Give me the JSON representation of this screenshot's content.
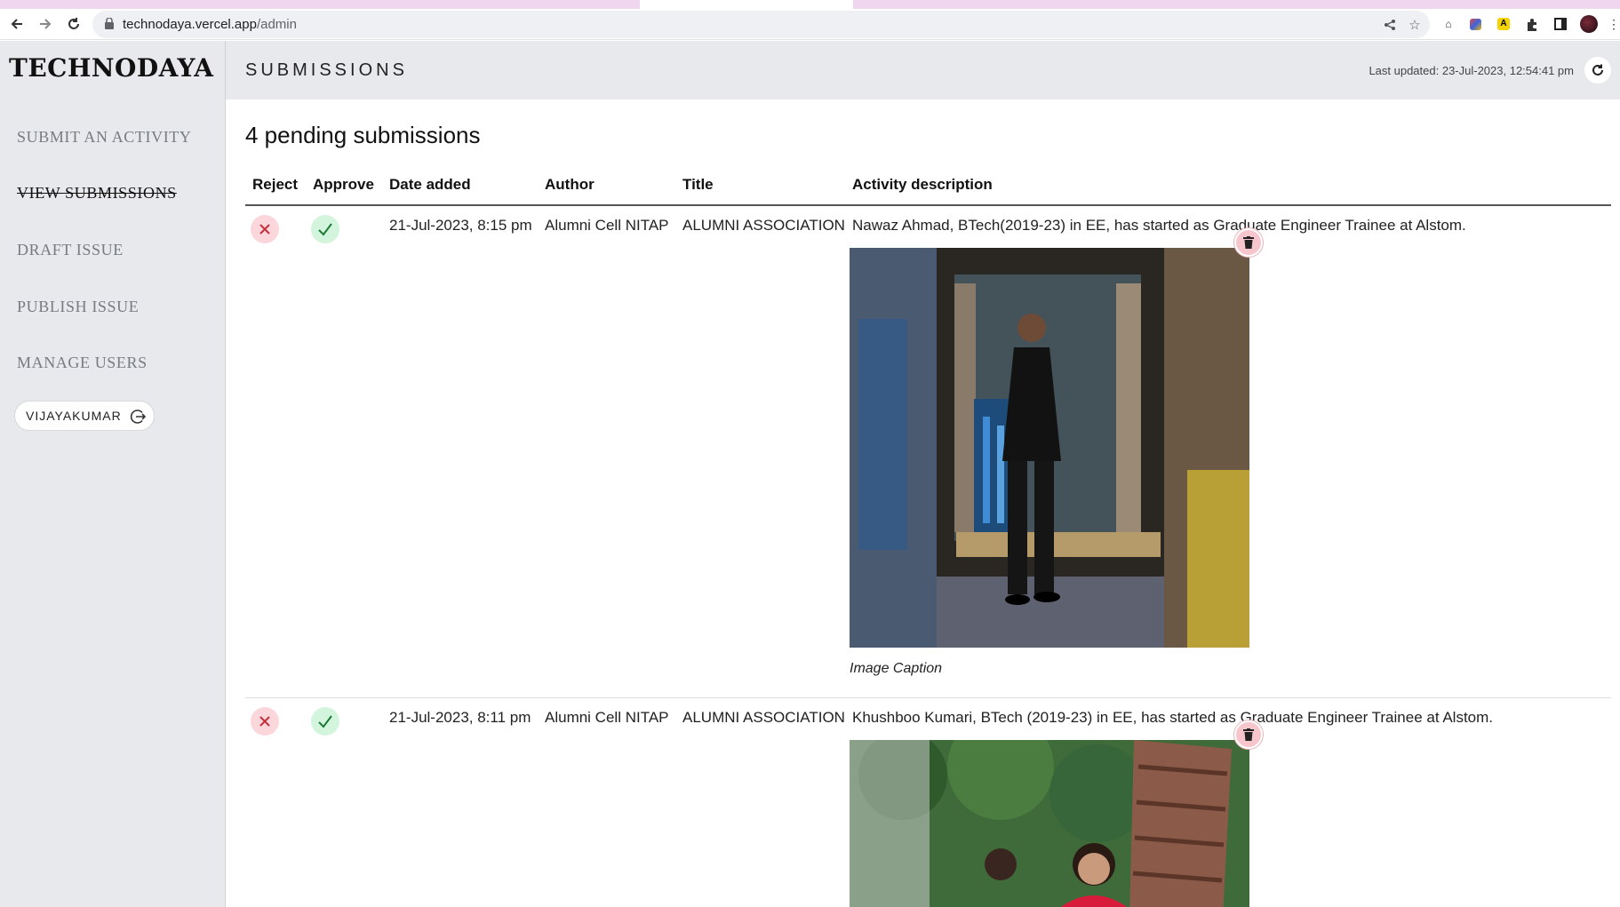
{
  "browser": {
    "url_host": "technodaya.vercel.app",
    "url_path": "/admin"
  },
  "sidebar": {
    "logo": "TECHNODAYA",
    "items": [
      {
        "label": "SUBMIT AN ACTIVITY"
      },
      {
        "label": "VIEW SUBMISSIONS"
      },
      {
        "label": "DRAFT ISSUE"
      },
      {
        "label": "PUBLISH ISSUE"
      },
      {
        "label": "MANAGE USERS"
      }
    ],
    "user": "VIJAYAKUMAR"
  },
  "header": {
    "title": "SUBMISSIONS",
    "last_updated": "Last updated: 23-Jul-2023, 12:54:41 pm"
  },
  "main": {
    "heading": "4 pending submissions",
    "columns": [
      "Reject",
      "Approve",
      "Date added",
      "Author",
      "Title",
      "Activity description"
    ],
    "rows": [
      {
        "date": "21-Jul-2023, 8:15 pm",
        "author": "Alumni Cell NITAP",
        "title": "ALUMNI ASSOCIATION",
        "description": "Nawaz Ahmad, BTech(2019-23) in EE, has started as Graduate Engineer Trainee at Alstom.",
        "caption": "Image Caption"
      },
      {
        "date": "21-Jul-2023, 8:11 pm",
        "author": "Alumni Cell NITAP",
        "title": "ALUMNI ASSOCIATION",
        "description": "Khushboo Kumari, BTech (2019-23) in EE, has started as Graduate Engineer Trainee at Alstom."
      }
    ]
  },
  "colors": {
    "sidebar_bg": "#e7e9ec",
    "reject_bg": "#fbd7dc",
    "approve_bg": "#d3f5dd",
    "reject_icon": "#c62f3c",
    "approve_icon": "#1a7a35"
  },
  "icons": [
    "back-icon",
    "forward-icon",
    "reload-icon",
    "lock-icon",
    "share-icon",
    "star-icon",
    "extension-icon",
    "sidepanel-icon",
    "profile-avatar",
    "logout-icon",
    "refresh-icon",
    "close-icon",
    "check-icon",
    "trash-icon"
  ]
}
